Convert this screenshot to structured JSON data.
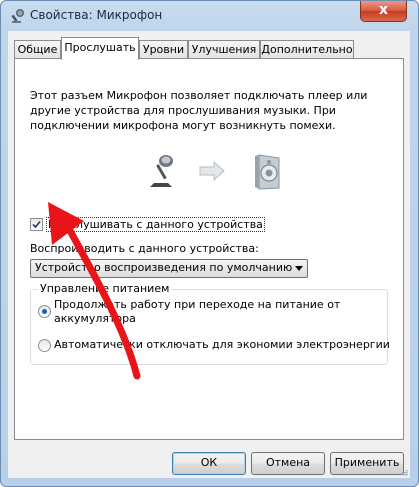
{
  "window": {
    "title": "Свойства: Микрофон",
    "close_label": "x"
  },
  "tabs": [
    {
      "label": "Общие",
      "active": false
    },
    {
      "label": "Прослушать",
      "active": true
    },
    {
      "label": "Уровни",
      "active": false
    },
    {
      "label": "Улучшения",
      "active": false
    },
    {
      "label": "Дополнительно",
      "active": false
    }
  ],
  "listen": {
    "description": "Этот разъем Микрофон позволяет подключать плеер или другие устройства для прослушивания музыки. При подключении микрофона могут возникнуть помехи.",
    "listen_checkbox_label": "Прослушивать с данного устройства",
    "listen_checked": true,
    "playback_label": "Воспроизводить с данного устройства:",
    "playback_selected": "Устройство воспроизведения по умолчанию"
  },
  "power": {
    "group_title": "Управление питанием",
    "option_continue": "Продолжать работу при переходе на питание от аккумулятора",
    "option_disable": "Автоматически отключать для экономии электроэнергии",
    "selected": "continue"
  },
  "buttons": {
    "ok": "ОК",
    "cancel": "Отмена",
    "apply": "Применить"
  },
  "icons": {
    "app": "microphone-icon",
    "source": "microphone-icon",
    "direction": "arrow-right-icon",
    "target": "speaker-icon",
    "annotation": "red-arrow-icon"
  },
  "colors": {
    "title_bar": "#bfd5ec",
    "close_button": "#d9573c",
    "annotation_arrow": "#e8141a",
    "radio_dot": "#1b5fb4"
  }
}
